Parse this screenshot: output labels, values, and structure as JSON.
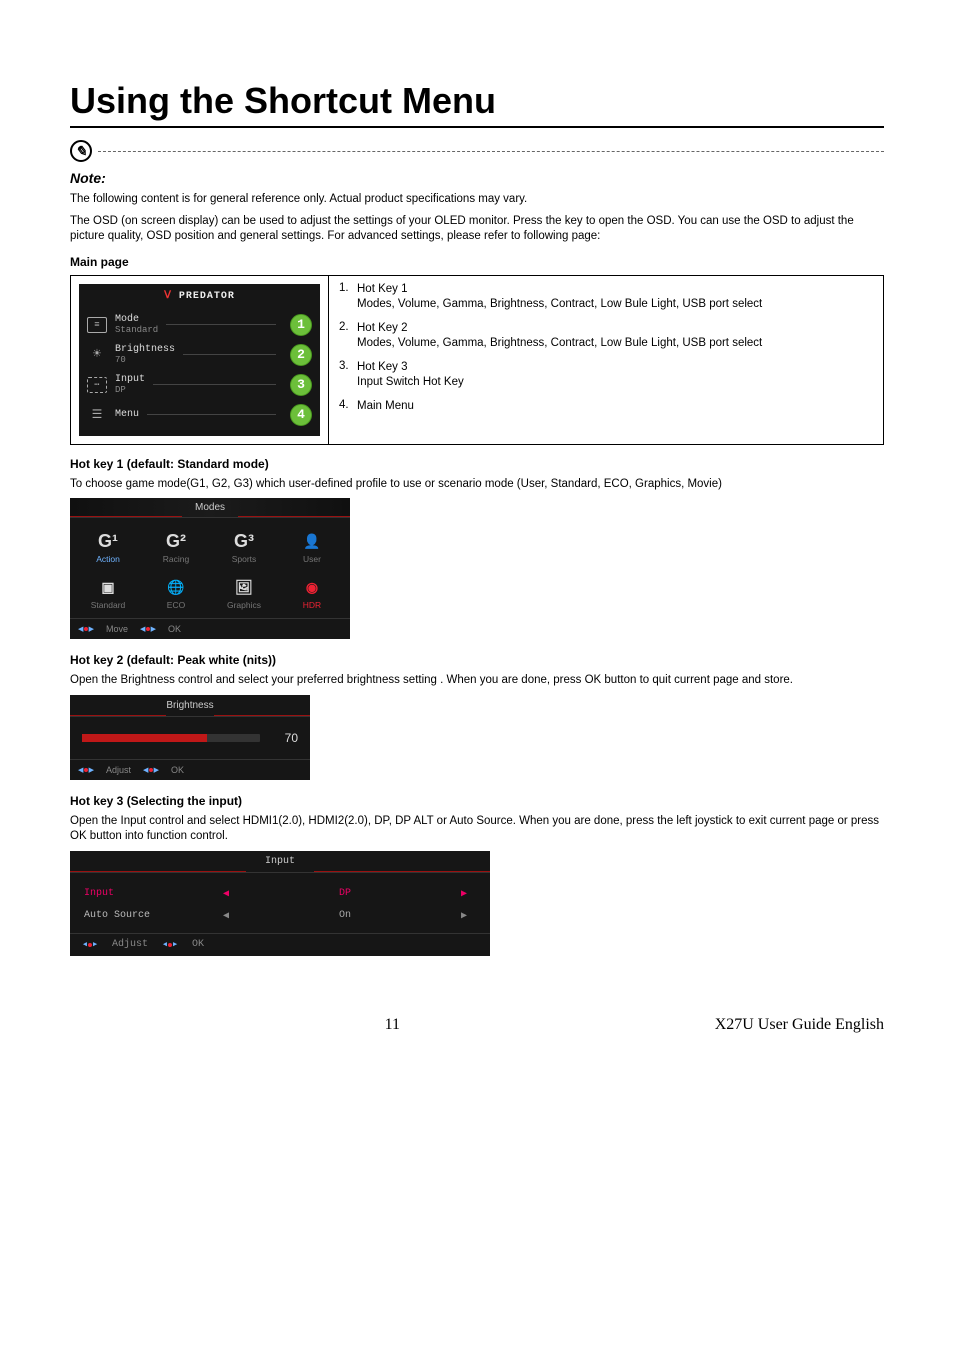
{
  "title": "Using the Shortcut Menu",
  "note_label": "Note:",
  "intro1": "The following content is for general reference only. Actual product specifications may vary.",
  "intro2": "The OSD (on screen display) can be used to adjust the settings of your OLED monitor. Press the key to open the OSD. You can use the OSD to adjust the picture quality, OSD position and general settings. For advanced settings, please refer to following page:",
  "mainpage_heading": "Main page",
  "osd_main": {
    "logo": "PREDATOR",
    "rows": [
      {
        "label": "Mode",
        "sub": "Standard",
        "callout": "1",
        "icon": "mode"
      },
      {
        "label": "Brightness",
        "sub": "70",
        "callout": "2",
        "icon": "sun"
      },
      {
        "label": "Input",
        "sub": "DP",
        "callout": "3",
        "icon": "input"
      },
      {
        "label": "Menu",
        "sub": "",
        "callout": "4",
        "icon": "list"
      }
    ]
  },
  "hotkeys": [
    {
      "num": "1.",
      "title": "Hot Key 1",
      "desc": "Modes, Volume, Gamma, Brightness, Contract, Low Bule Light, USB port select"
    },
    {
      "num": "2.",
      "title": "Hot Key 2",
      "desc": "Modes, Volume, Gamma, Brightness, Contract, Low Bule Light, USB port select"
    },
    {
      "num": "3.",
      "title": "Hot Key 3",
      "desc": "Input Switch Hot Key"
    },
    {
      "num": "4.",
      "title": "Main Menu",
      "desc": ""
    }
  ],
  "hk1": {
    "heading": "Hot key 1 (default: Standard mode)",
    "desc": "To choose game mode(G1, G2, G3) which user-defined profile to use or scenario mode (User, Standard, ECO, Graphics, Movie)",
    "panel_title": "Modes",
    "modes": [
      {
        "icon": "G¹",
        "label": "Action",
        "sel": true
      },
      {
        "icon": "G²",
        "label": "Racing"
      },
      {
        "icon": "G³",
        "label": "Sports"
      },
      {
        "icon": "👤",
        "label": "User"
      },
      {
        "icon": "▣",
        "label": "Standard"
      },
      {
        "icon": "🌐",
        "label": "ECO"
      },
      {
        "icon": "🖼",
        "label": "Graphics"
      },
      {
        "icon": "◉",
        "label": "HDR",
        "hdr": true
      }
    ],
    "foot_move": "Move",
    "foot_ok": "OK"
  },
  "hk2": {
    "heading": "Hot key 2 (default: Peak white (nits))",
    "desc": "Open the Brightness control and select your preferred brightness setting . When you are done, press OK button to quit current page and store.",
    "panel_title": "Brightness",
    "value": "70",
    "foot_adjust": "Adjust",
    "foot_ok": "OK"
  },
  "hk3": {
    "heading": "Hot key 3 (Selecting the input)",
    "desc": "Open the Input control and select HDMI1(2.0), HDMI2(2.0), DP, DP ALT or Auto Source. When you are done, press the left joystick to exit current page or press OK button into function control.",
    "panel_title": "Input",
    "rows": [
      {
        "label": "Input",
        "value": "DP",
        "sel": true
      },
      {
        "label": "Auto Source",
        "value": "On"
      }
    ],
    "foot_adjust": "Adjust",
    "foot_ok": "OK"
  },
  "footer": {
    "page": "11",
    "guide": "X27U User Guide English"
  }
}
